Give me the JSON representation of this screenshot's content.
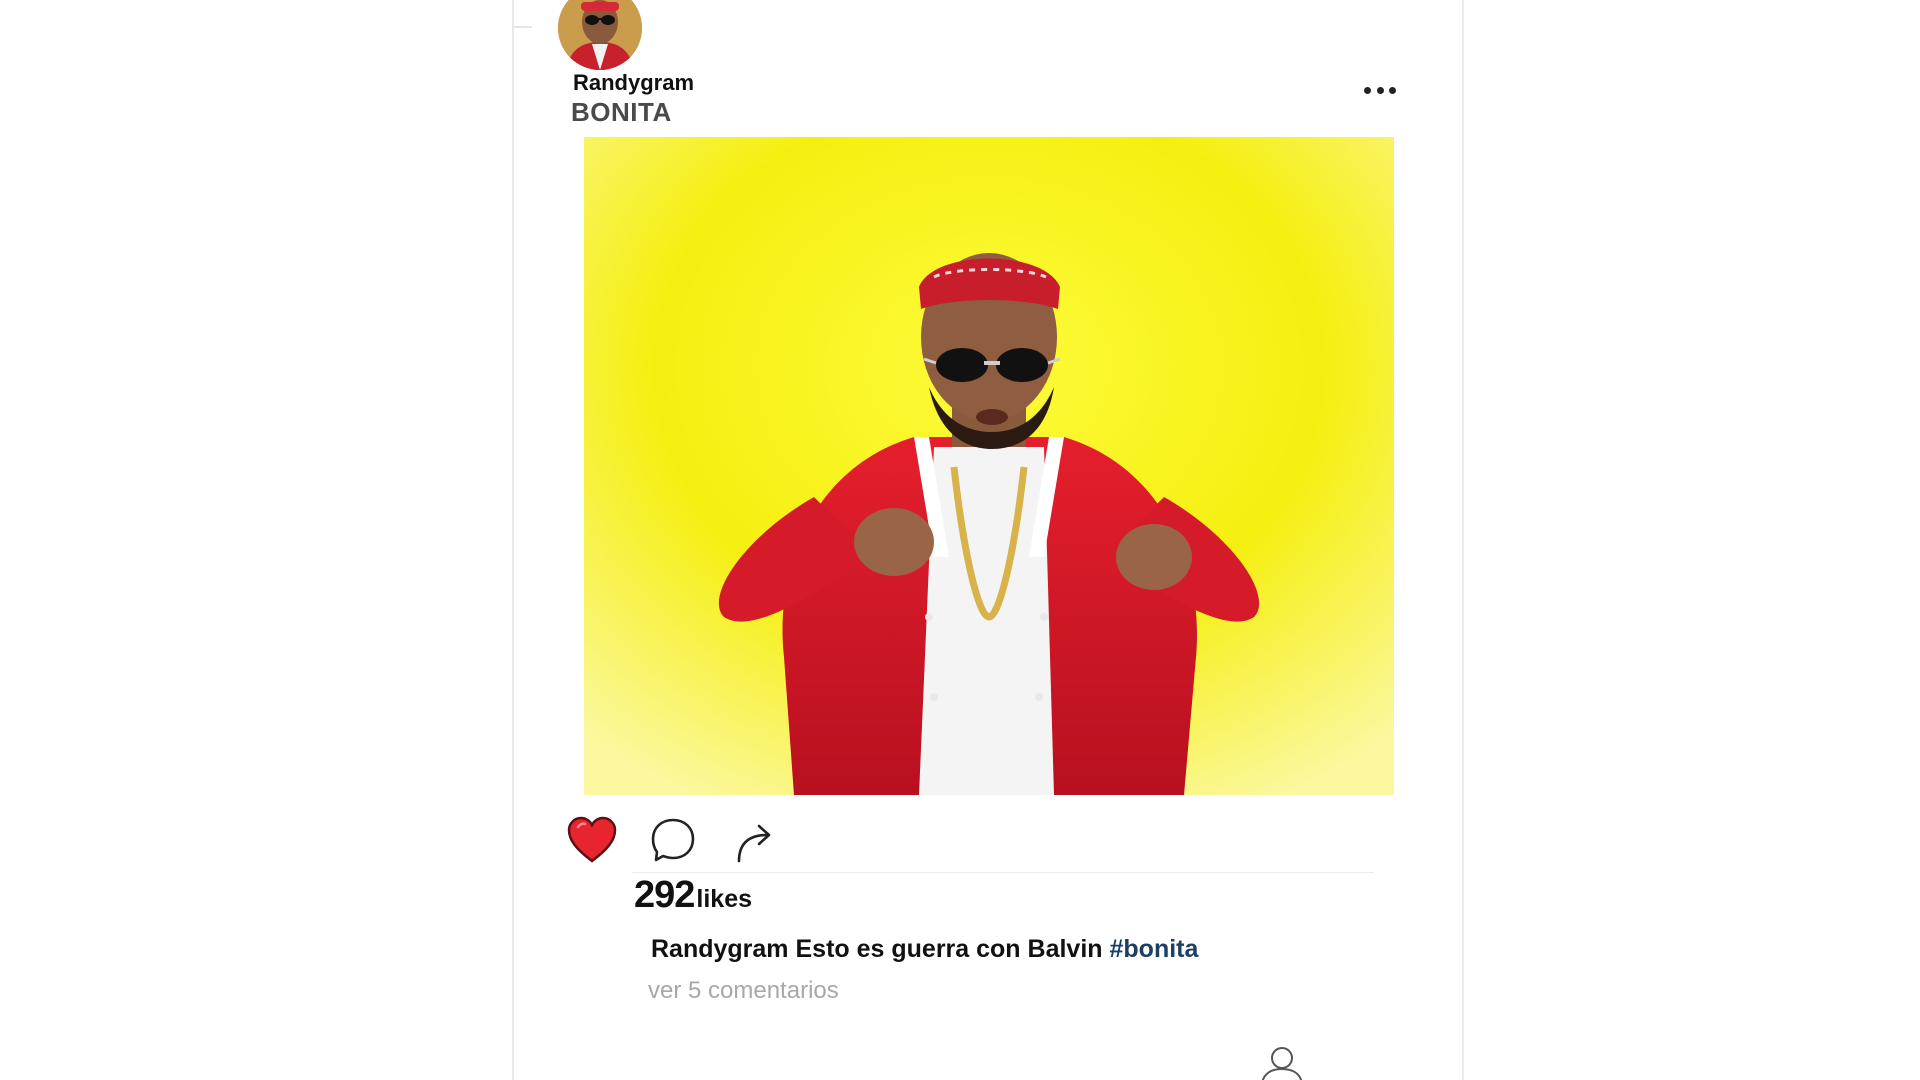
{
  "post": {
    "username": "Randygram",
    "subtitle": "BONITA",
    "likes_count": "292",
    "likes_label": "likes",
    "caption_username": "Randygram",
    "caption_text": "Esto es guerra con Balvin",
    "caption_hashtag": "#bonita",
    "view_comments": "ver 5 comentarios",
    "liked": true
  },
  "icons": {
    "more": "more-options-icon",
    "like": "heart-icon",
    "comment": "comment-icon",
    "share": "share-icon",
    "profile": "profile-icon"
  },
  "colors": {
    "heart": "#e8242f",
    "photo_background": "#f7f20a",
    "hashtag": "#1d3f66",
    "muted_text": "#a8a8a8",
    "jacket": "#d8182a"
  }
}
